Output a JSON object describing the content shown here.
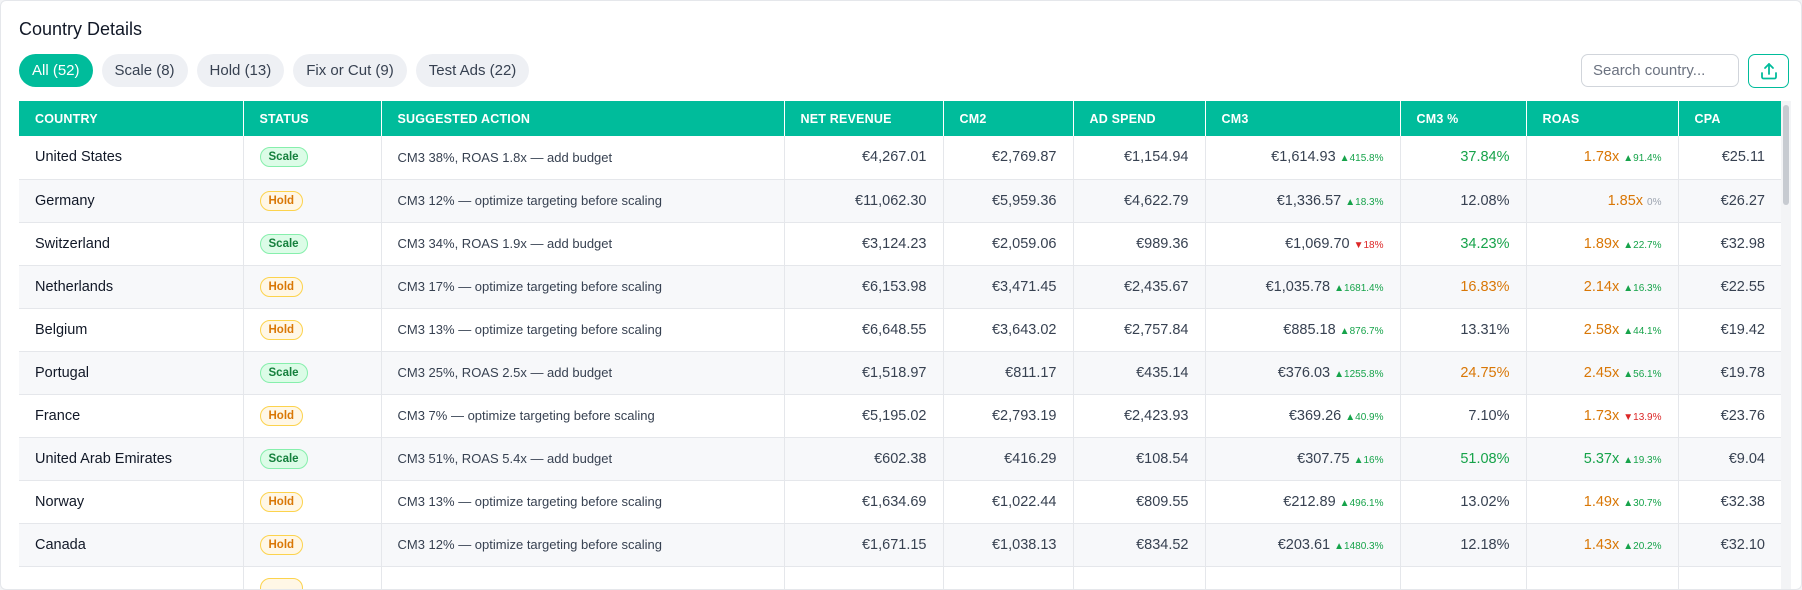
{
  "title": "Country Details",
  "filters": [
    {
      "label": "All (52)",
      "active": true
    },
    {
      "label": "Scale (8)",
      "active": false
    },
    {
      "label": "Hold (13)",
      "active": false
    },
    {
      "label": "Fix or Cut (9)",
      "active": false
    },
    {
      "label": "Test Ads (22)",
      "active": false
    }
  ],
  "search": {
    "placeholder": "Search country..."
  },
  "colors": {
    "accent": "#00bc9b",
    "scale": "#15803d",
    "hold": "#d97706",
    "up": "#16a34a",
    "down": "#dc2626"
  },
  "icons": {
    "export": "upload-icon"
  },
  "columns": [
    "COUNTRY",
    "STATUS",
    "SUGGESTED ACTION",
    "NET REVENUE",
    "CM2",
    "AD SPEND",
    "CM3",
    "CM3 %",
    "ROAS",
    "CPA"
  ],
  "rows": [
    {
      "country": "United States",
      "status": "Scale",
      "action": "CM3 38%, ROAS 1.8x — add budget",
      "net_revenue": "€4,267.01",
      "cm2": "€2,769.87",
      "ad_spend": "€1,154.94",
      "cm3": "€1,614.93",
      "cm3_change": "415.8%",
      "cm3_dir": "up",
      "cm3_pct": "37.84%",
      "cm3_pct_tone": "good",
      "roas": "1.78x",
      "roas_tone": "mid",
      "roas_change": "91.4%",
      "roas_dir": "up",
      "cpa": "€25.11"
    },
    {
      "country": "Germany",
      "status": "Hold",
      "action": "CM3 12% — optimize targeting before scaling",
      "net_revenue": "€11,062.30",
      "cm2": "€5,959.36",
      "ad_spend": "€4,622.79",
      "cm3": "€1,336.57",
      "cm3_change": "18.3%",
      "cm3_dir": "up",
      "cm3_pct": "12.08%",
      "cm3_pct_tone": "neutral",
      "roas": "1.85x",
      "roas_tone": "mid",
      "roas_change": "0%",
      "roas_dir": "flat",
      "cpa": "€26.27"
    },
    {
      "country": "Switzerland",
      "status": "Scale",
      "action": "CM3 34%, ROAS 1.9x — add budget",
      "net_revenue": "€3,124.23",
      "cm2": "€2,059.06",
      "ad_spend": "€989.36",
      "cm3": "€1,069.70",
      "cm3_change": "18%",
      "cm3_dir": "down",
      "cm3_pct": "34.23%",
      "cm3_pct_tone": "good",
      "roas": "1.89x",
      "roas_tone": "mid",
      "roas_change": "22.7%",
      "roas_dir": "up",
      "cpa": "€32.98"
    },
    {
      "country": "Netherlands",
      "status": "Hold",
      "action": "CM3 17% — optimize targeting before scaling",
      "net_revenue": "€6,153.98",
      "cm2": "€3,471.45",
      "ad_spend": "€2,435.67",
      "cm3": "€1,035.78",
      "cm3_change": "1681.4%",
      "cm3_dir": "up",
      "cm3_pct": "16.83%",
      "cm3_pct_tone": "mid",
      "roas": "2.14x",
      "roas_tone": "mid",
      "roas_change": "16.3%",
      "roas_dir": "up",
      "cpa": "€22.55"
    },
    {
      "country": "Belgium",
      "status": "Hold",
      "action": "CM3 13% — optimize targeting before scaling",
      "net_revenue": "€6,648.55",
      "cm2": "€3,643.02",
      "ad_spend": "€2,757.84",
      "cm3": "€885.18",
      "cm3_change": "876.7%",
      "cm3_dir": "up",
      "cm3_pct": "13.31%",
      "cm3_pct_tone": "neutral",
      "roas": "2.58x",
      "roas_tone": "mid",
      "roas_change": "44.1%",
      "roas_dir": "up",
      "cpa": "€19.42"
    },
    {
      "country": "Portugal",
      "status": "Scale",
      "action": "CM3 25%, ROAS 2.5x — add budget",
      "net_revenue": "€1,518.97",
      "cm2": "€811.17",
      "ad_spend": "€435.14",
      "cm3": "€376.03",
      "cm3_change": "1255.8%",
      "cm3_dir": "up",
      "cm3_pct": "24.75%",
      "cm3_pct_tone": "mid",
      "roas": "2.45x",
      "roas_tone": "mid",
      "roas_change": "56.1%",
      "roas_dir": "up",
      "cpa": "€19.78"
    },
    {
      "country": "France",
      "status": "Hold",
      "action": "CM3 7% — optimize targeting before scaling",
      "net_revenue": "€5,195.02",
      "cm2": "€2,793.19",
      "ad_spend": "€2,423.93",
      "cm3": "€369.26",
      "cm3_change": "40.9%",
      "cm3_dir": "up",
      "cm3_pct": "7.10%",
      "cm3_pct_tone": "neutral",
      "roas": "1.73x",
      "roas_tone": "mid",
      "roas_change": "13.9%",
      "roas_dir": "down",
      "cpa": "€23.76"
    },
    {
      "country": "United Arab Emirates",
      "status": "Scale",
      "action": "CM3 51%, ROAS 5.4x — add budget",
      "net_revenue": "€602.38",
      "cm2": "€416.29",
      "ad_spend": "€108.54",
      "cm3": "€307.75",
      "cm3_change": "16%",
      "cm3_dir": "up",
      "cm3_pct": "51.08%",
      "cm3_pct_tone": "good",
      "roas": "5.37x",
      "roas_tone": "good",
      "roas_change": "19.3%",
      "roas_dir": "up",
      "cpa": "€9.04"
    },
    {
      "country": "Norway",
      "status": "Hold",
      "action": "CM3 13% — optimize targeting before scaling",
      "net_revenue": "€1,634.69",
      "cm2": "€1,022.44",
      "ad_spend": "€809.55",
      "cm3": "€212.89",
      "cm3_change": "496.1%",
      "cm3_dir": "up",
      "cm3_pct": "13.02%",
      "cm3_pct_tone": "neutral",
      "roas": "1.49x",
      "roas_tone": "mid",
      "roas_change": "30.7%",
      "roas_dir": "up",
      "cpa": "€32.38"
    },
    {
      "country": "Canada",
      "status": "Hold",
      "action": "CM3 12% — optimize targeting before scaling",
      "net_revenue": "€1,671.15",
      "cm2": "€1,038.13",
      "ad_spend": "€834.52",
      "cm3": "€203.61",
      "cm3_change": "1480.3%",
      "cm3_dir": "up",
      "cm3_pct": "12.18%",
      "cm3_pct_tone": "neutral",
      "roas": "1.43x",
      "roas_tone": "mid",
      "roas_change": "20.2%",
      "roas_dir": "up",
      "cpa": "€32.10"
    }
  ]
}
